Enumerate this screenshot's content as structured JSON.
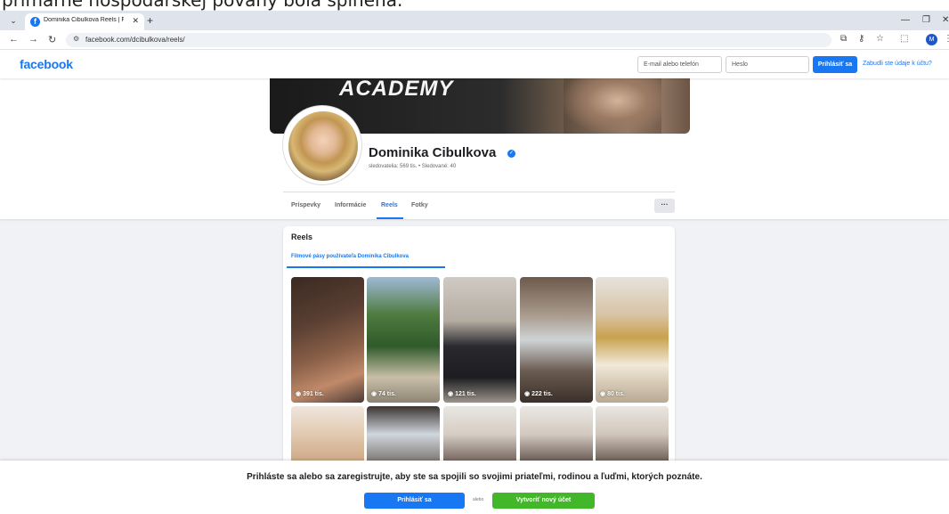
{
  "document_text": "primárne hospodárskej povahy bola splnená.",
  "browser": {
    "tab_title": "Dominika Cibulkova Reels | Faceb",
    "url": "facebook.com/dcibulkova/reels/",
    "profile_initial": "M"
  },
  "header": {
    "logo": "facebook",
    "email_placeholder": "E-mail alebo telefón",
    "password_placeholder": "Heslo",
    "login_label": "Prihlásiť sa",
    "forgot_label": "Zabudli ste údaje k účtu?"
  },
  "profile": {
    "cover_text": "ACADEMY",
    "name": "Dominika Cibulkova",
    "stats": "sledovatelia: 569 tis. • Sledované: 40",
    "tabs": [
      "Príspevky",
      "Informácie",
      "Reels",
      "Fotky"
    ],
    "active_tab": "Reels",
    "more_label": "···"
  },
  "reels": {
    "title": "Reels",
    "subtab": "Filmové pásy používateľa Dominika Cibulkova",
    "items": [
      {
        "views": "391 tis."
      },
      {
        "views": "74 tis."
      },
      {
        "views": "121 tis."
      },
      {
        "views": "222 tis."
      },
      {
        "views": "80 tis."
      }
    ]
  },
  "bottom": {
    "message": "Prihláste sa alebo sa zaregistrujte, aby ste sa spojili so svojimi priateľmi, rodinou a ľuďmi, ktorých poznáte.",
    "login_label": "Prihlásiť sa",
    "or_label": "alebo",
    "create_label": "Vytvoriť nový účet"
  },
  "colors": {
    "brand": "#1877f2",
    "create": "#42b72a",
    "page_bg": "#f0f2f5"
  }
}
